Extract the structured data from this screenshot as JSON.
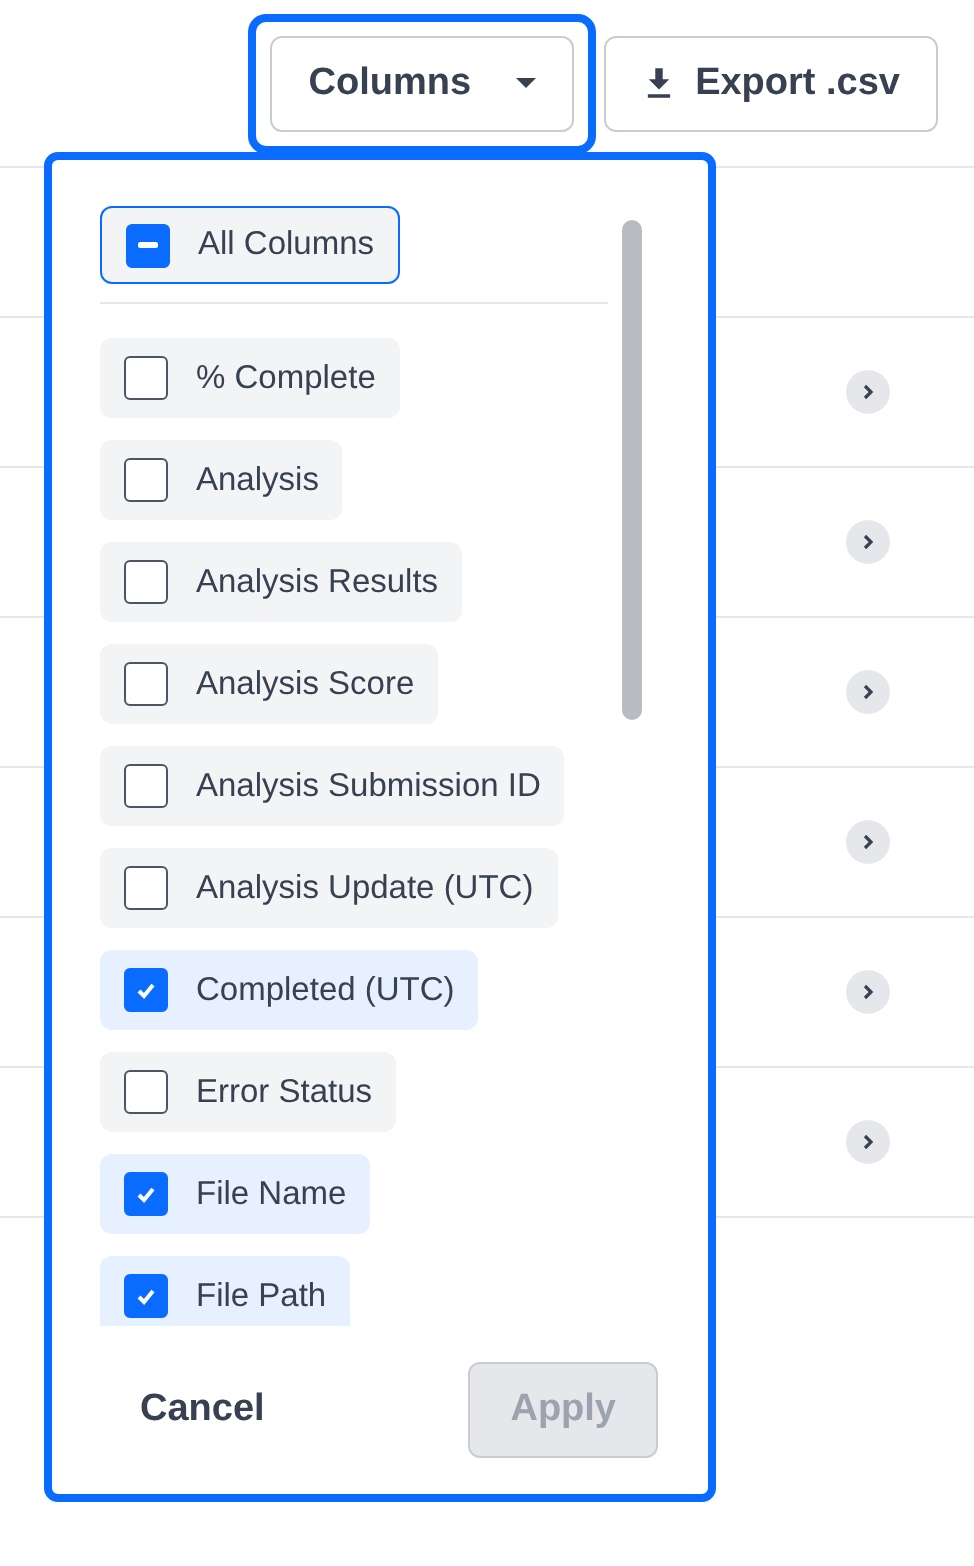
{
  "toolbar": {
    "columns_button": {
      "label": "Columns",
      "focused": true,
      "expanded": true
    },
    "export_button": {
      "label": "Export .csv"
    }
  },
  "table": {
    "rows": [
      {
        "kind": "expandable"
      },
      {
        "kind": "expandable"
      },
      {
        "kind": "expandable"
      },
      {
        "kind": "expandable"
      },
      {
        "kind": "expandable"
      },
      {
        "kind": "expandable"
      }
    ]
  },
  "columns_menu": {
    "all": {
      "label": "All Columns",
      "indeterminate": true
    },
    "items": [
      {
        "label": "% Complete",
        "checked": false
      },
      {
        "label": "Analysis",
        "checked": false
      },
      {
        "label": "Analysis Results",
        "checked": false
      },
      {
        "label": "Analysis Score",
        "checked": false
      },
      {
        "label": "Analysis Submission ID",
        "checked": false
      },
      {
        "label": "Analysis Update (UTC)",
        "checked": false
      },
      {
        "label": "Completed (UTC)",
        "checked": true
      },
      {
        "label": "Error Status",
        "checked": false
      },
      {
        "label": "File Name",
        "checked": true
      },
      {
        "label": "File Path",
        "checked": true
      }
    ],
    "cancel": "Cancel",
    "apply": {
      "label": "Apply",
      "disabled": true
    }
  }
}
